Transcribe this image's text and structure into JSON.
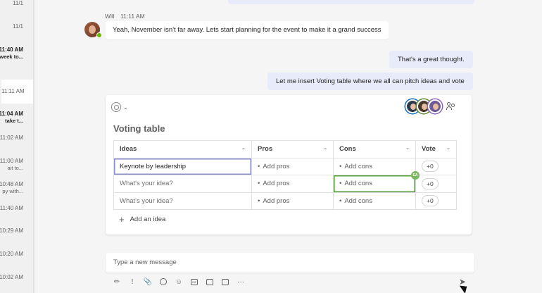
{
  "sidebar": {
    "items": [
      {
        "time": "11/1",
        "preview": ""
      },
      {
        "time": "11/1",
        "preview": ""
      },
      {
        "time": "11:40 AM",
        "preview": "week to..."
      },
      {
        "time": "11:11 AM",
        "preview": ""
      },
      {
        "time": "11:04 AM",
        "preview": "take t..."
      },
      {
        "time": "11:02 AM",
        "preview": ""
      },
      {
        "time": "11:00 AM",
        "preview": "ait to..."
      },
      {
        "time": "10:48 AM",
        "preview": "py with..."
      },
      {
        "time": "11:40 AM",
        "preview": ""
      },
      {
        "time": "10:29 AM",
        "preview": ""
      },
      {
        "time": "10:20 AM",
        "preview": ""
      },
      {
        "time": "10:02 AM",
        "preview": ""
      }
    ]
  },
  "messages": {
    "incoming": {
      "sender": "Will",
      "time": "11:11 AM",
      "text": "Yeah, November isn't far away. Lets start planning for the event to make it a grand success"
    },
    "outgoing_1": "That's a great thought.",
    "outgoing_2": "Let me insert Voting table where we all can pitch ideas and vote"
  },
  "loop_card": {
    "title": "Voting table",
    "columns": [
      "Ideas",
      "Pros",
      "Cons",
      "Vote"
    ],
    "rows": [
      {
        "idea": "Keynote by leadership",
        "pros": "Add pros",
        "cons": "Add cons",
        "vote": "+0"
      },
      {
        "idea": "What's your idea?",
        "pros": "Add pros",
        "cons": "Add cons",
        "vote": "+0"
      },
      {
        "idea": "What's your idea?",
        "pros": "Add pros",
        "cons": "Add cons",
        "vote": "+0"
      }
    ],
    "coauthor_badge": "EA",
    "add_idea": "Add an idea",
    "collaborator_icons": [
      "avatar-1",
      "avatar-2",
      "avatar-3"
    ]
  },
  "compose": {
    "placeholder": "Type a new message",
    "toolbar_icons": [
      "format-icon",
      "priority-icon",
      "attach-icon",
      "loop-icon",
      "emoji-icon",
      "gif-icon",
      "sticker-icon",
      "schedule-icon",
      "more-icon"
    ],
    "gif_label": "GIF",
    "more_label": "···"
  },
  "colors": {
    "outgoing_bubble": "#e8ebfa",
    "presence": "#6bb700",
    "coauthor": "#4e9a2f"
  }
}
